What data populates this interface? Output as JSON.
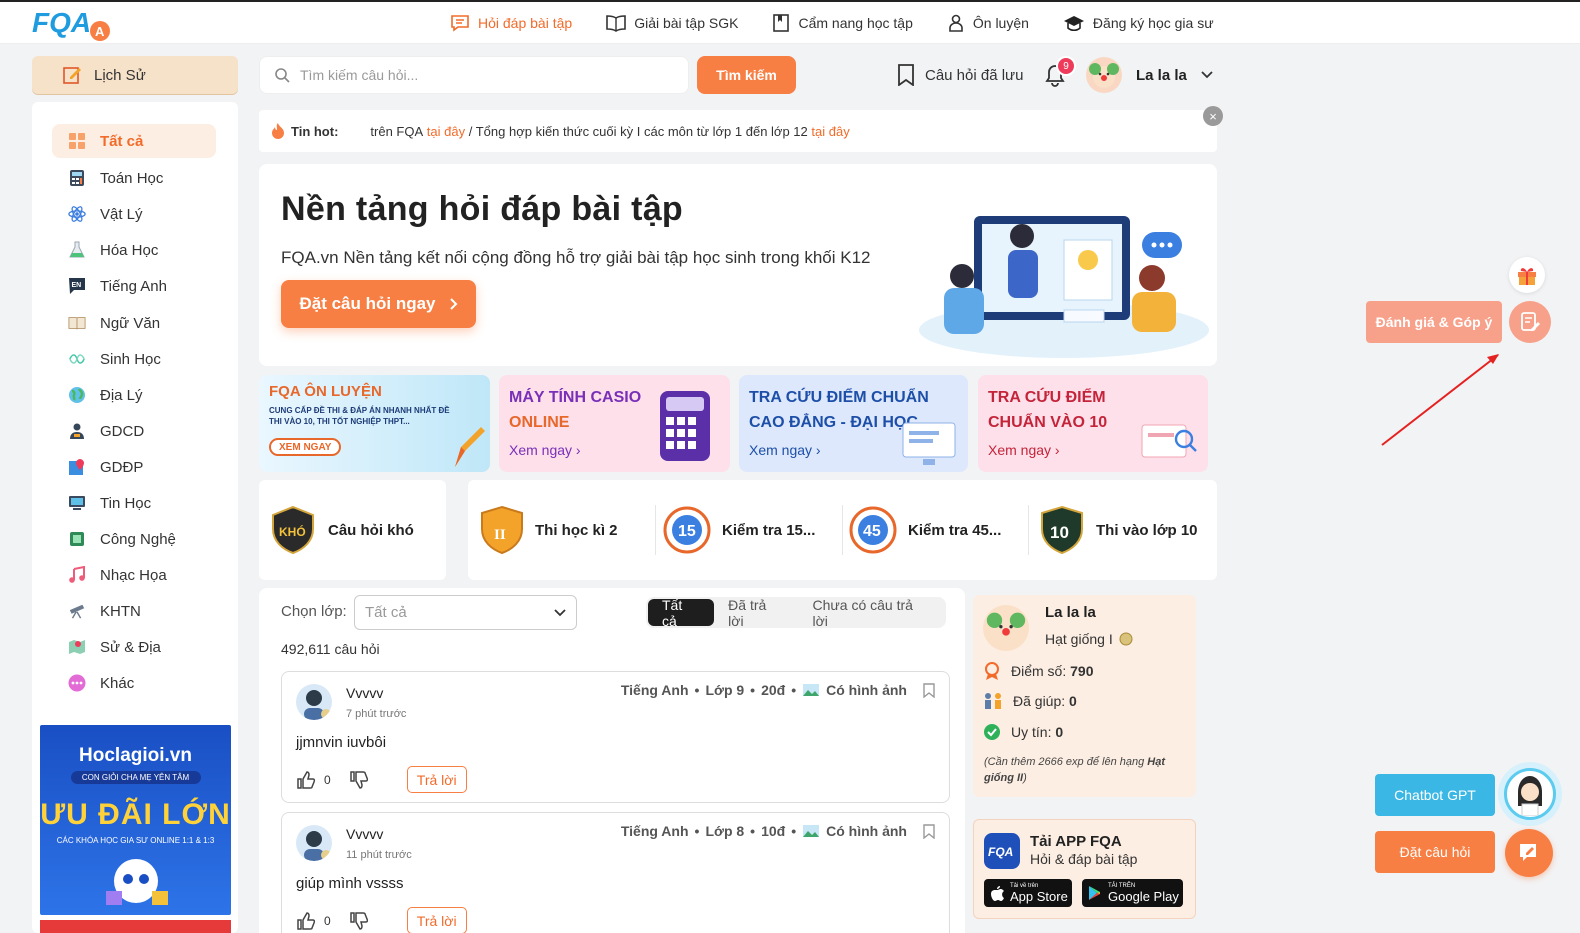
{
  "brand": {
    "logo_text": "FQA",
    "accent": "#f87f43"
  },
  "nav": [
    {
      "label": "Hỏi đáp bài tập",
      "icon": "chat-icon",
      "active": true
    },
    {
      "label": "Giải bài tập SGK",
      "icon": "book-icon"
    },
    {
      "label": "Cẩm nang học tập",
      "icon": "notebook-icon"
    },
    {
      "label": "Ôn luyện",
      "icon": "trophy-icon"
    },
    {
      "label": "Đăng ký học gia sư",
      "icon": "graduation-cap-icon"
    }
  ],
  "history": {
    "label": "Lịch Sử"
  },
  "sidebar": {
    "items": [
      {
        "label": "Tất cả",
        "icon": "grid-icon",
        "active": true
      },
      {
        "label": "Toán Học",
        "icon": "calculator-icon"
      },
      {
        "label": "Vật Lý",
        "icon": "atom-icon"
      },
      {
        "label": "Hóa Học",
        "icon": "flask-icon"
      },
      {
        "label": "Tiếng Anh",
        "icon": "english-icon"
      },
      {
        "label": "Ngữ Văn",
        "icon": "open-book-icon"
      },
      {
        "label": "Sinh Học",
        "icon": "dna-icon"
      },
      {
        "label": "Địa Lý",
        "icon": "globe-icon"
      },
      {
        "label": "GDCD",
        "icon": "person-icon"
      },
      {
        "label": "GDĐP",
        "icon": "map-pin-icon"
      },
      {
        "label": "Tin Học",
        "icon": "monitor-icon"
      },
      {
        "label": "Công Nghệ",
        "icon": "chip-icon"
      },
      {
        "label": "Nhạc Họa",
        "icon": "music-icon"
      },
      {
        "label": "KHTN",
        "icon": "telescope-icon"
      },
      {
        "label": "Sử & Địa",
        "icon": "map-icon"
      },
      {
        "label": "Khác",
        "icon": "more-icon"
      }
    ]
  },
  "ad": {
    "site": "Hoclagioi.vn",
    "tagline": "CON GIỎI CHA MẸ YÊN TÂM",
    "headline": "ƯU ĐÃI LỚN",
    "desc": "CÁC KHÓA HỌC GIA SƯ ONLINE 1:1 & 1:3"
  },
  "search": {
    "placeholder": "Tìm kiếm câu hỏi...",
    "button": "Tìm kiếm"
  },
  "header": {
    "saved_label": "Câu hỏi đã lưu",
    "notifications": "9",
    "username": "La la la"
  },
  "news": {
    "label": "Tin hot:",
    "text1": "trên FQA",
    "link1": "tại đây",
    "text2": "/ Tổng hợp kiến thức cuối kỳ I các môn từ lớp 1 đến lớp 12",
    "link2": "tại đây"
  },
  "hero": {
    "title": "Nền tảng hỏi đáp bài tập",
    "subtitle": "FQA.vn Nền tảng kết nối cộng đồng hỗ trợ giải bài tập học sinh trong khối K12",
    "cta": "Đặt câu hỏi ngay"
  },
  "banners": [
    {
      "title": "FQA ÔN LUYỆN",
      "desc": "CUNG CẤP ĐỀ THI & ĐÁP ÁN NHANH NHẤT ĐỀ THI VÀO 10, THI TỐT NGHIỆP THPT...",
      "cta": "XEM NGAY"
    },
    {
      "title1": "MÁY TÍNH CASIO",
      "title2": "ONLINE",
      "cta": "Xem ngay"
    },
    {
      "title1": "TRA CỨU ĐIỂM CHUẨN",
      "title2": "CAO ĐẲNG - ĐẠI HỌC",
      "cta": "Xem ngay"
    },
    {
      "title1": "TRA CỨU ĐIỂM",
      "title2": "CHUẨN VÀO 10",
      "cta": "Xem ngay"
    }
  ],
  "quick": {
    "hard": {
      "label": "Câu hỏi khó",
      "badge": "KHÓ"
    },
    "items": [
      {
        "label": "Thi học kì 2",
        "badge": "II"
      },
      {
        "label": "Kiểm tra 15...",
        "badge": "15"
      },
      {
        "label": "Kiểm tra 45...",
        "badge": "45"
      },
      {
        "label": "Thi vào lớp 10",
        "badge": "10"
      }
    ]
  },
  "filter": {
    "class_label": "Chọn lớp:",
    "class_value": "Tất cả",
    "tabs": [
      "Tất cả",
      "Đã trả lời",
      "Chưa có câu trả lời"
    ],
    "active_tab": 0,
    "count": "492,611 câu hỏi"
  },
  "questions": [
    {
      "user": "Vvvvv",
      "time": "7 phút trước",
      "subject": "Tiếng Anh",
      "grade": "Lớp 9",
      "points": "20đ",
      "has_image": "Có hình ảnh",
      "body": "jjmnvin  iuvbôi",
      "likes": "0",
      "reply": "Trả lời"
    },
    {
      "user": "Vvvvv",
      "time": "11 phút trước",
      "subject": "Tiếng Anh",
      "grade": "Lớp 8",
      "points": "10đ",
      "has_image": "Có hình ảnh",
      "body": "giúp mình vssss",
      "likes": "0",
      "reply": "Trả lời"
    }
  ],
  "profile": {
    "name": "La la la",
    "rank": "Hạt giống I",
    "score_label": "Điểm số:",
    "score": "790",
    "helped_label": "Đã giúp:",
    "helped": "0",
    "trust_label": "Uy tín:",
    "trust": "0",
    "note_pre": "(Cần thêm 2666 exp để lên hạng ",
    "note_rank": "Hạt giống II",
    "note_post": ")"
  },
  "app": {
    "title": "Tải APP FQA",
    "subtitle": "Hỏi & đáp bài tập",
    "appstore_small": "Tải về trên",
    "appstore": "App Store",
    "gplay_small": "TẢI TRÊN",
    "gplay": "Google Play"
  },
  "floating": {
    "feedback": "Đánh giá & Góp ý",
    "chatbot": "Chatbot GPT",
    "ask": "Đặt câu hỏi"
  }
}
